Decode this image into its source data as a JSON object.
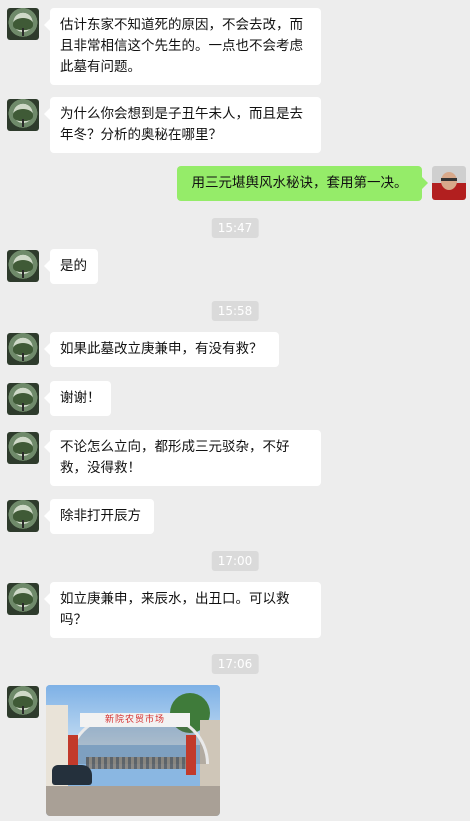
{
  "messages": [
    {
      "side": "left",
      "text": "估计东家不知道死的原因，不会去改，而且非常相信这个先生的。一点也不会考虑此墓有问题。"
    },
    {
      "side": "left",
      "text": "为什么你会想到是子丑午未人，而且是去年冬？分析的奥秘在哪里？"
    },
    {
      "side": "right",
      "text": "用三元堪舆风水秘诀，套用第一决。"
    },
    {
      "side": "left",
      "text": "是的"
    },
    {
      "side": "left",
      "text": "如果此墓改立庚兼申，有没有救？"
    },
    {
      "side": "left",
      "text": "谢谢！"
    },
    {
      "side": "left",
      "text": "不论怎么立向，都形成三元驳杂，不好救，没得救！"
    },
    {
      "side": "left",
      "text": "除非打开辰方"
    },
    {
      "side": "left",
      "text": "如立庚兼申，来辰水，出丑口。可以救吗？"
    }
  ],
  "timestamps": [
    "15:47",
    "15:58",
    "17:00",
    "17:06"
  ],
  "photo": {
    "sign_text": "新院农贸市场"
  }
}
